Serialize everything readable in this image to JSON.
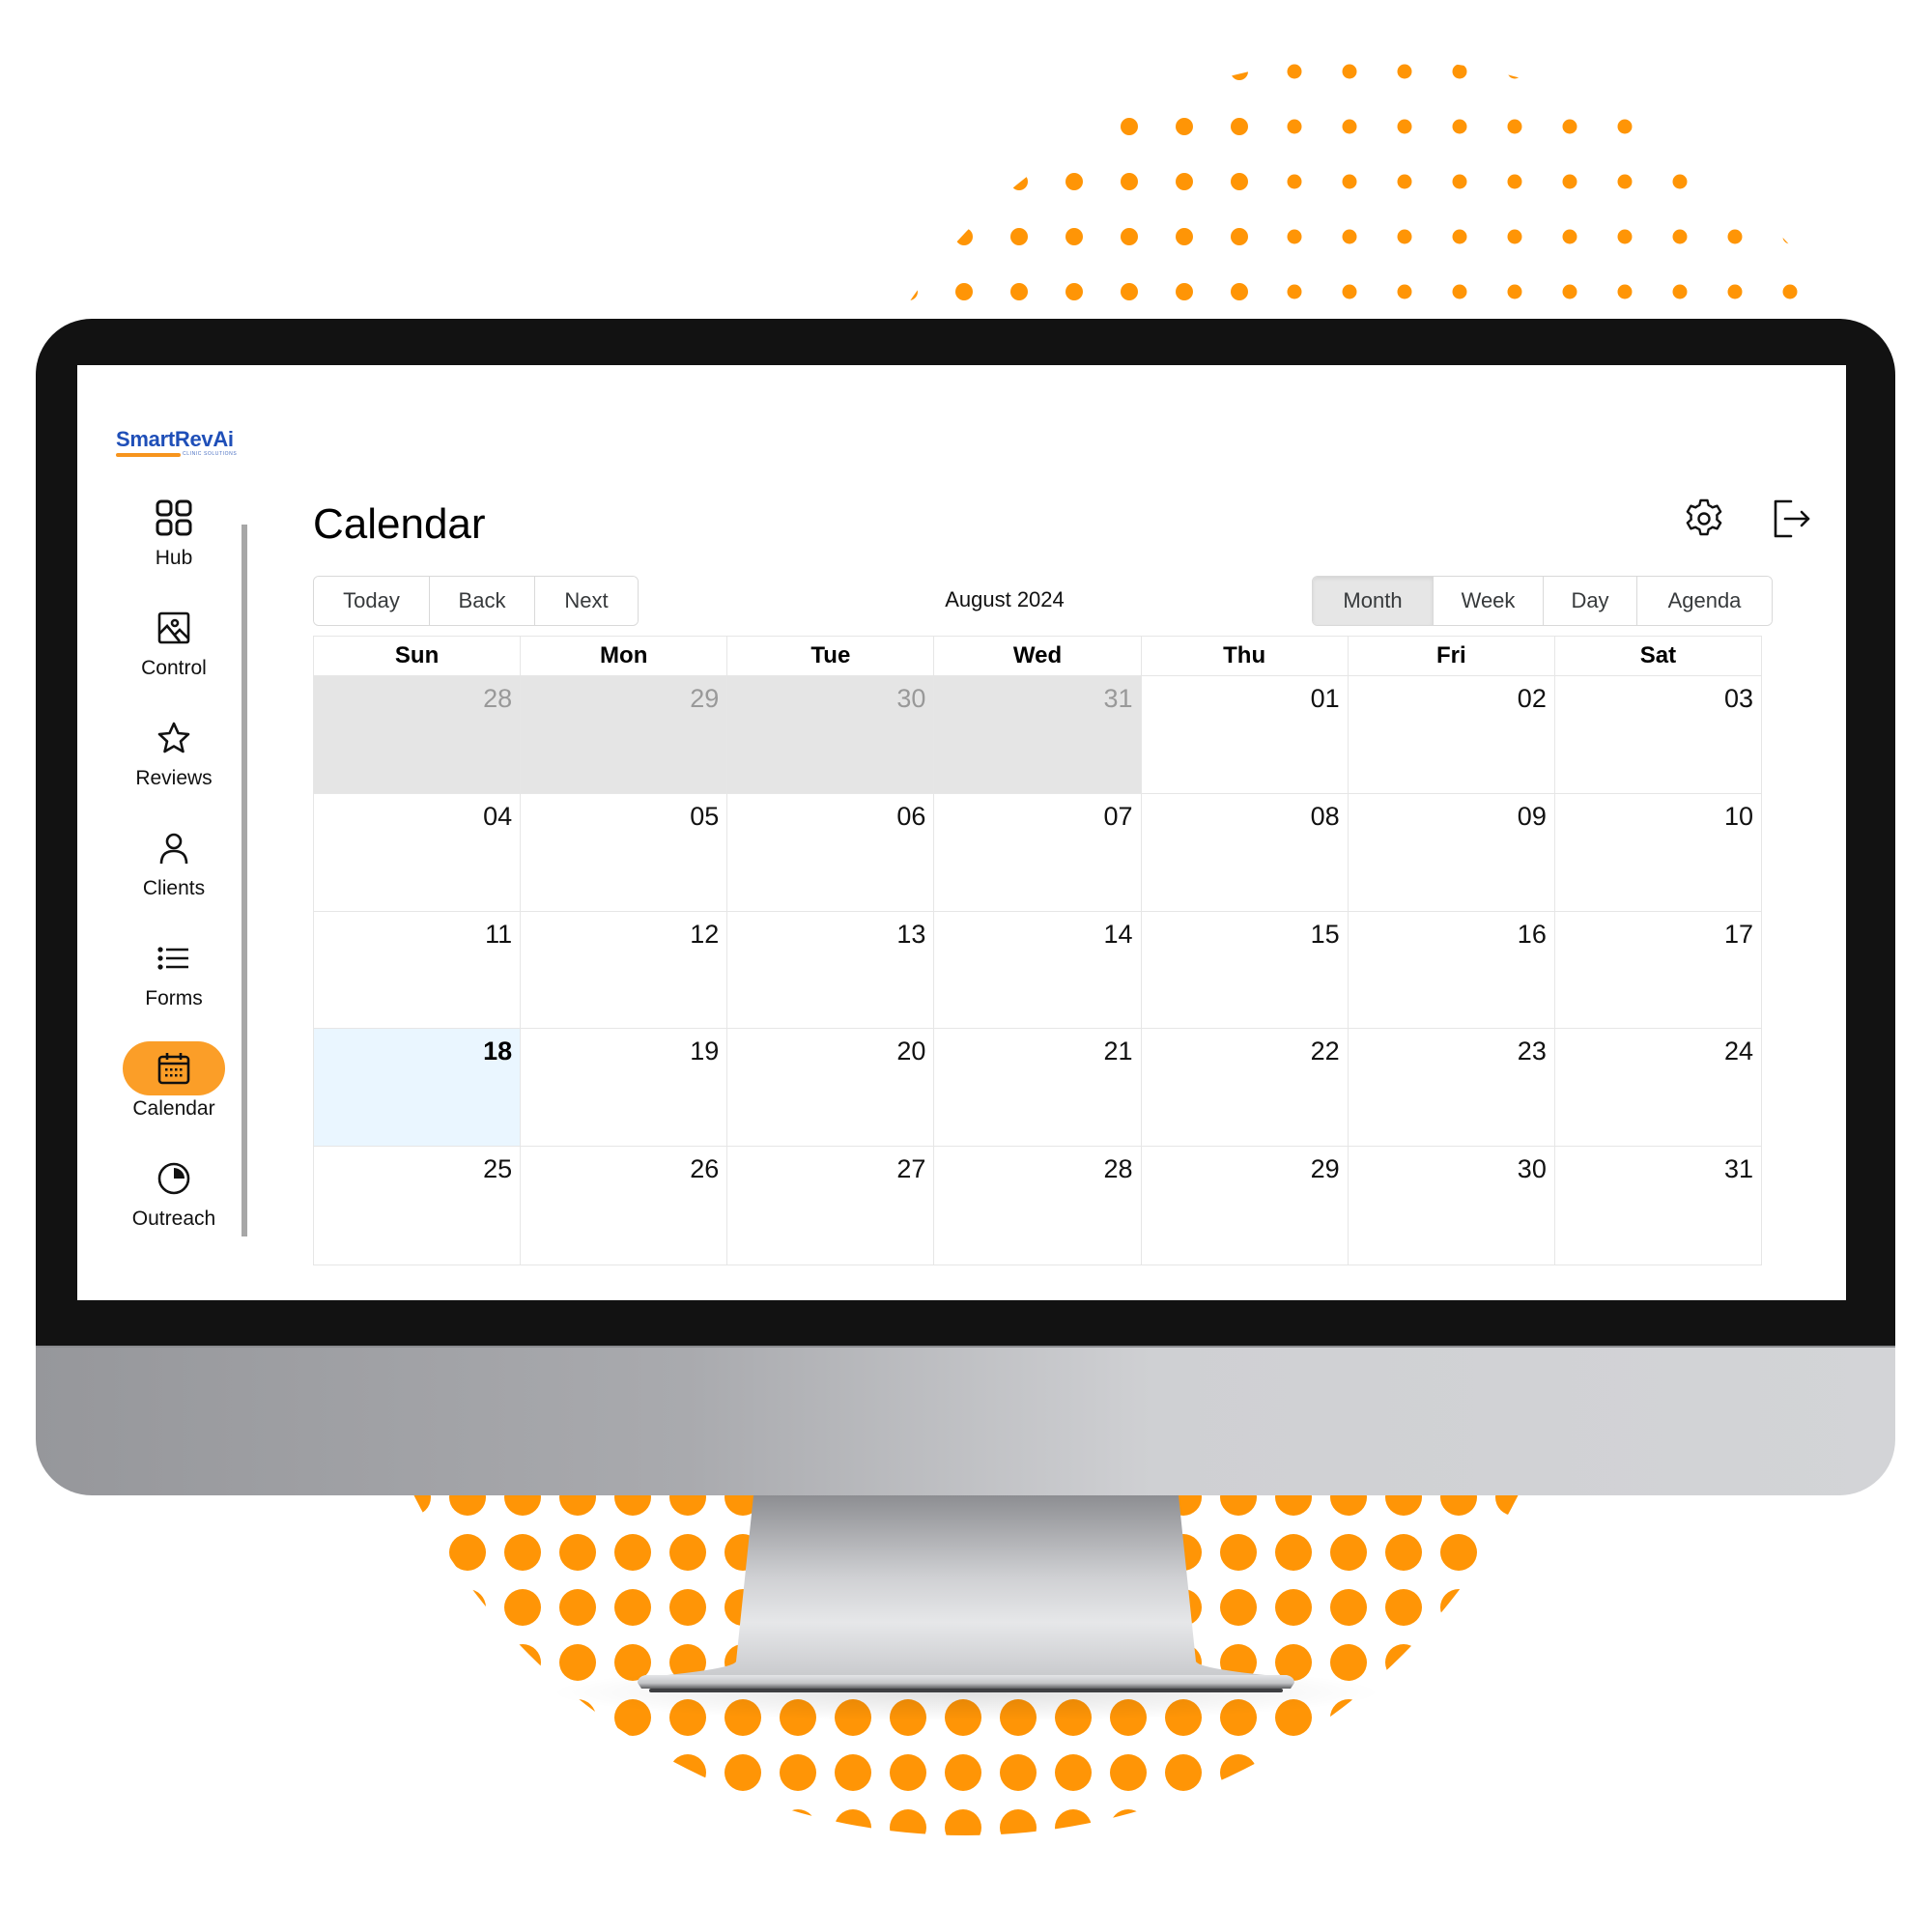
{
  "brand": {
    "name": "SmartRevAi",
    "tagline": "CLINIC SOLUTIONS",
    "accent": "#fb9e28",
    "brand_blue": "#1f4fb8"
  },
  "sidebar": {
    "items": [
      {
        "label": "Hub",
        "icon": "grid-icon",
        "active": false
      },
      {
        "label": "Control",
        "icon": "image-icon",
        "active": false
      },
      {
        "label": "Reviews",
        "icon": "star-icon",
        "active": false
      },
      {
        "label": "Clients",
        "icon": "user-icon",
        "active": false
      },
      {
        "label": "Forms",
        "icon": "list-icon",
        "active": false
      },
      {
        "label": "Calendar",
        "icon": "calendar-icon",
        "active": true
      },
      {
        "label": "Outreach",
        "icon": "pie-chart-icon",
        "active": false
      }
    ]
  },
  "header": {
    "title": "Calendar",
    "settings_icon": "gear-icon",
    "logout_icon": "logout-icon"
  },
  "toolbar": {
    "nav_buttons": [
      "Today",
      "Back",
      "Next"
    ],
    "current_label": "August 2024",
    "views": [
      "Month",
      "Week",
      "Day",
      "Agenda"
    ],
    "active_view": "Month"
  },
  "calendar": {
    "weekdays": [
      "Sun",
      "Mon",
      "Tue",
      "Wed",
      "Thu",
      "Fri",
      "Sat"
    ],
    "weeks": [
      [
        {
          "d": "28",
          "off": true
        },
        {
          "d": "29",
          "off": true
        },
        {
          "d": "30",
          "off": true
        },
        {
          "d": "31",
          "off": true
        },
        {
          "d": "01"
        },
        {
          "d": "02"
        },
        {
          "d": "03"
        }
      ],
      [
        {
          "d": "04"
        },
        {
          "d": "05"
        },
        {
          "d": "06"
        },
        {
          "d": "07"
        },
        {
          "d": "08"
        },
        {
          "d": "09"
        },
        {
          "d": "10"
        }
      ],
      [
        {
          "d": "11"
        },
        {
          "d": "12"
        },
        {
          "d": "13"
        },
        {
          "d": "14"
        },
        {
          "d": "15"
        },
        {
          "d": "16"
        },
        {
          "d": "17"
        }
      ],
      [
        {
          "d": "18",
          "today": true
        },
        {
          "d": "19"
        },
        {
          "d": "20"
        },
        {
          "d": "21"
        },
        {
          "d": "22"
        },
        {
          "d": "23"
        },
        {
          "d": "24"
        }
      ],
      [
        {
          "d": "25"
        },
        {
          "d": "26"
        },
        {
          "d": "27"
        },
        {
          "d": "28"
        },
        {
          "d": "29"
        },
        {
          "d": "30"
        },
        {
          "d": "31"
        }
      ]
    ],
    "colors": {
      "off_day_bg": "#e5e5e5",
      "today_bg": "#eaf6ff",
      "grid_line": "#e6e6e6"
    }
  },
  "decoration": {
    "dot_color": "#ff9506"
  }
}
